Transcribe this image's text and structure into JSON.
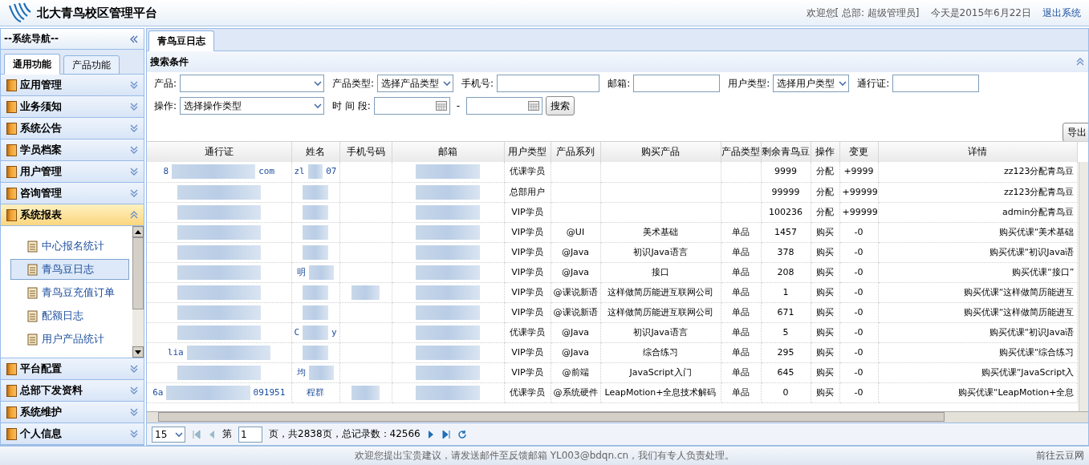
{
  "header": {
    "title": "北大青鸟校区管理平台",
    "welcome": "欢迎您[ 总部:  超级管理员]",
    "date": "今天是2015年6月22日",
    "logout": "退出系统"
  },
  "sidebar": {
    "title": "--系统导航--",
    "tabs": [
      {
        "label": "通用功能",
        "selected": true
      },
      {
        "label": "产品功能",
        "selected": false
      }
    ],
    "items": [
      {
        "label": "应用管理",
        "expanded": false
      },
      {
        "label": "业务须知",
        "expanded": false
      },
      {
        "label": "系统公告",
        "expanded": false
      },
      {
        "label": "学员档案",
        "expanded": false
      },
      {
        "label": "用户管理",
        "expanded": false
      },
      {
        "label": "咨询管理",
        "expanded": false
      },
      {
        "label": "系统报表",
        "expanded": true,
        "children": [
          {
            "label": "中心报名统计",
            "selected": false
          },
          {
            "label": "青鸟豆日志",
            "selected": true
          },
          {
            "label": "青鸟豆充值订单",
            "selected": false
          },
          {
            "label": "配额日志",
            "selected": false
          },
          {
            "label": "用户产品统计",
            "selected": false
          }
        ]
      },
      {
        "label": "平台配置",
        "expanded": false
      },
      {
        "label": "总部下发资料",
        "expanded": false
      },
      {
        "label": "系统维护",
        "expanded": false
      },
      {
        "label": "个人信息",
        "expanded": false
      }
    ]
  },
  "tabs": [
    {
      "label": "青鸟豆日志",
      "selected": true
    }
  ],
  "search": {
    "title": "搜索条件",
    "rows": [
      [
        {
          "kind": "select",
          "label": "产品:"
        },
        {
          "kind": "select",
          "label": "产品类型:",
          "value": "选择产品类型"
        },
        {
          "kind": "text",
          "label": "手机号:"
        },
        {
          "kind": "text",
          "label": "邮箱:"
        },
        {
          "kind": "select",
          "label": "用户类型:",
          "value": "选择用户类型"
        },
        {
          "kind": "text",
          "label": "通行证:"
        }
      ],
      [
        {
          "kind": "select",
          "label": "操作:",
          "value": "选择操作类型"
        },
        {
          "kind": "date",
          "label": "时 间 段:"
        },
        {
          "kind": "dash",
          "label": "-"
        },
        {
          "kind": "date"
        },
        {
          "kind": "button",
          "label": "搜索"
        }
      ]
    ]
  },
  "export_button": "导出",
  "table": {
    "columns": [
      "通行证",
      "姓名",
      "手机号码",
      "邮箱",
      "用户类型",
      "产品系列",
      "购买产品",
      "产品类型",
      "剩余青鸟豆",
      "操作",
      "变更",
      "详情"
    ],
    "rows": [
      {
        "pass": {
          "blurred": true,
          "parts": [
            "8",
            "com"
          ]
        },
        "name": {
          "blurred": true,
          "parts": [
            "zl",
            "07"
          ]
        },
        "phone": {
          "blurred": false
        },
        "email": {
          "blurred": true
        },
        "user_type": "优课学员",
        "series": "",
        "product": "",
        "product_type": "",
        "beans": "9999",
        "op": "分配",
        "change": "+9999",
        "detail": "zz123分配青鸟豆"
      },
      {
        "pass": {
          "blurred": true
        },
        "name": {
          "blurred": true
        },
        "phone": {
          "blurred": false
        },
        "email": {
          "blurred": true
        },
        "user_type": "总部用户",
        "series": "",
        "product": "",
        "product_type": "",
        "beans": "99999",
        "op": "分配",
        "change": "+99999",
        "detail": "zz123分配青鸟豆"
      },
      {
        "pass": {
          "blurred": true
        },
        "name": {
          "blurred": true
        },
        "phone": {
          "blurred": false
        },
        "email": {
          "blurred": true
        },
        "user_type": "VIP学员",
        "series": "",
        "product": "",
        "product_type": "",
        "beans": "100236",
        "op": "分配",
        "change": "+99999",
        "detail": "admin分配青鸟豆"
      },
      {
        "pass": {
          "blurred": true
        },
        "name": {
          "blurred": true
        },
        "phone": {
          "blurred": false
        },
        "email": {
          "blurred": true
        },
        "user_type": "VIP学员",
        "series": "@UI",
        "product": "美术基础",
        "product_type": "单品",
        "beans": "1457",
        "op": "购买",
        "change": "-0",
        "detail": "购买优课“美术基础"
      },
      {
        "pass": {
          "blurred": true
        },
        "name": {
          "blurred": true
        },
        "phone": {
          "blurred": false
        },
        "email": {
          "blurred": true
        },
        "user_type": "VIP学员",
        "series": "@Java",
        "product": "初识Java语言",
        "product_type": "单品",
        "beans": "378",
        "op": "购买",
        "change": "-0",
        "detail": "购买优课“初识Java语"
      },
      {
        "pass": {
          "blurred": true
        },
        "name": {
          "blurred": true,
          "parts": [
            "明"
          ]
        },
        "phone": {
          "blurred": false
        },
        "email": {
          "blurred": true
        },
        "user_type": "VIP学员",
        "series": "@Java",
        "product": "接口",
        "product_type": "单品",
        "beans": "208",
        "op": "购买",
        "change": "-0",
        "detail": "购买优课“接口”"
      },
      {
        "pass": {
          "blurred": true
        },
        "name": {
          "blurred": true
        },
        "phone": {
          "blurred": true
        },
        "email": {
          "blurred": true
        },
        "user_type": "VIP学员",
        "series": "@课说新语",
        "product": "这样做简历能进互联网公司",
        "product_type": "单品",
        "beans": "1",
        "op": "购买",
        "change": "-0",
        "detail": "购买优课“这样做简历能进互"
      },
      {
        "pass": {
          "blurred": true
        },
        "name": {
          "blurred": true
        },
        "phone": {
          "blurred": false
        },
        "email": {
          "blurred": true
        },
        "user_type": "VIP学员",
        "series": "@课说新语",
        "product": "这样做简历能进互联网公司",
        "product_type": "单品",
        "beans": "671",
        "op": "购买",
        "change": "-0",
        "detail": "购买优课“这样做简历能进互"
      },
      {
        "pass": {
          "blurred": true
        },
        "name": {
          "blurred": true,
          "parts": [
            "C",
            "y"
          ]
        },
        "phone": {
          "blurred": false
        },
        "email": {
          "blurred": true
        },
        "user_type": "优课学员",
        "series": "@Java",
        "product": "初识Java语言",
        "product_type": "单品",
        "beans": "5",
        "op": "购买",
        "change": "-0",
        "detail": "购买优课“初识Java语"
      },
      {
        "pass": {
          "blurred": true,
          "parts": [
            "lia"
          ]
        },
        "name": {
          "blurred": true
        },
        "phone": {
          "blurred": false
        },
        "email": {
          "blurred": true
        },
        "user_type": "VIP学员",
        "series": "@Java",
        "product": "综合练习",
        "product_type": "单品",
        "beans": "295",
        "op": "购买",
        "change": "-0",
        "detail": "购买优课“综合练习"
      },
      {
        "pass": {
          "blurred": true
        },
        "name": {
          "blurred": true,
          "parts": [
            "均"
          ]
        },
        "phone": {
          "blurred": false
        },
        "email": {
          "blurred": true
        },
        "user_type": "VIP学员",
        "series": "@前端",
        "product": "JavaScript入门",
        "product_type": "单品",
        "beans": "645",
        "op": "购买",
        "change": "-0",
        "detail": "购买优课“JavaScript入"
      },
      {
        "pass": {
          "blurred": true,
          "parts": [
            "6a",
            "091951"
          ]
        },
        "name": {
          "blurred": false,
          "parts": [
            "程群"
          ]
        },
        "phone": {
          "blurred": true
        },
        "email": {
          "blurred": true
        },
        "user_type": "优课学员",
        "series": "@系统硬件",
        "product": "LeapMotion+全息技术解码",
        "product_type": "单品",
        "beans": "0",
        "op": "购买",
        "change": "-0",
        "detail": "购买优课“LeapMotion+全息"
      }
    ]
  },
  "pager": {
    "page_size": "15",
    "page_label": "第",
    "page": "1",
    "summary": "页，共2838页，总记录数：42566"
  },
  "footer": {
    "message": "欢迎您提出宝贵建议，请发送邮件至反馈邮箱 YL003@bdqn.cn，我们有专人负责处理。",
    "link": "前往云豆网"
  }
}
